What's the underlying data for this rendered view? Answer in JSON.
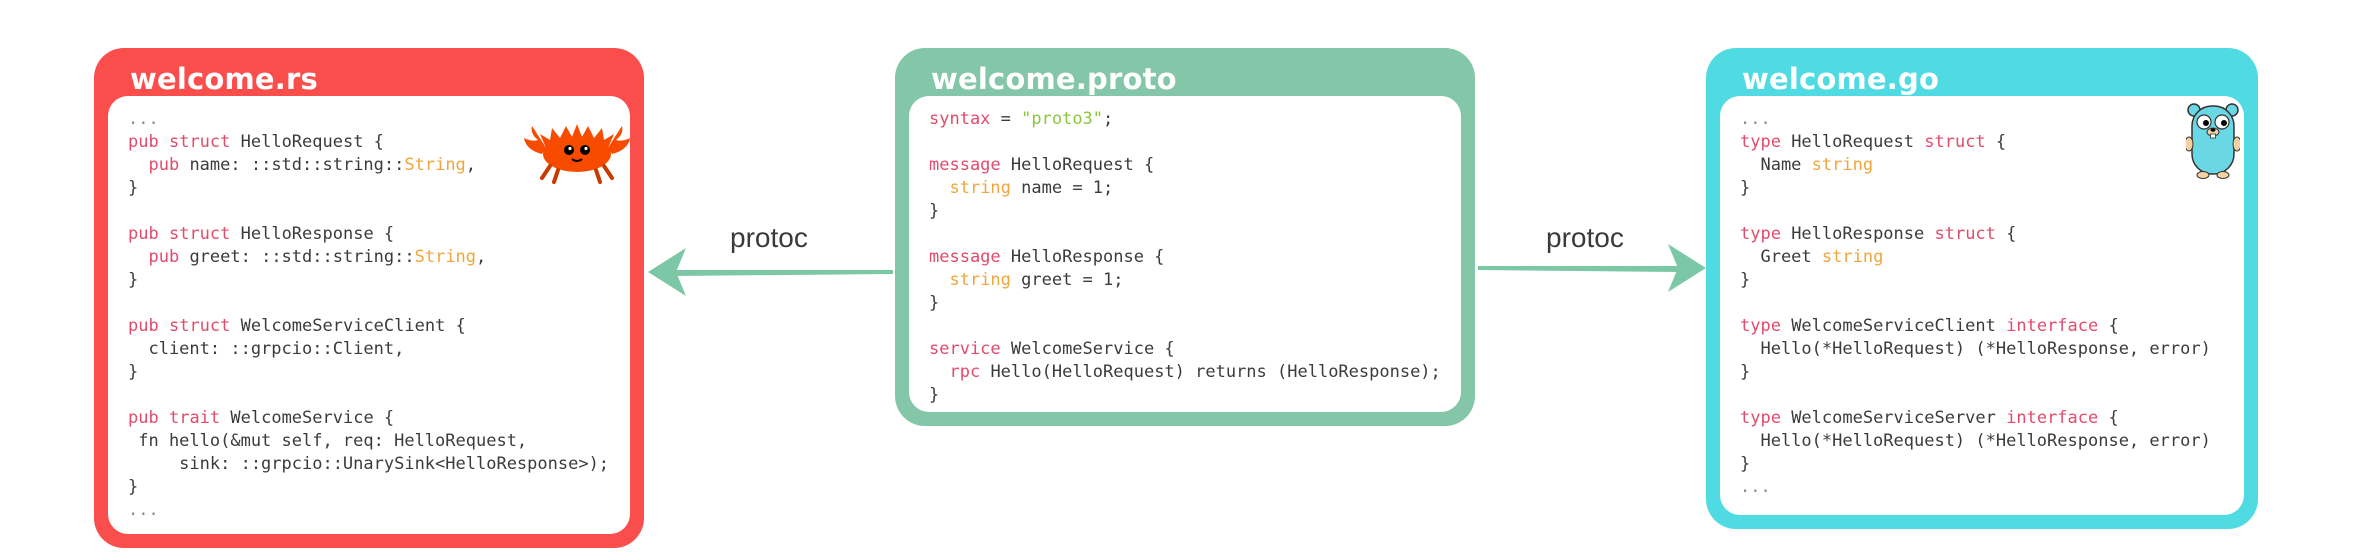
{
  "cards": {
    "rust": {
      "title": "welcome.rs",
      "lines": [
        [
          {
            "t": "...",
            "c": "dim"
          }
        ],
        [
          {
            "t": "pub",
            "c": "kw"
          },
          {
            "t": " "
          },
          {
            "t": "struct",
            "c": "kw"
          },
          {
            "t": " HelloRequest {"
          }
        ],
        [
          {
            "t": "  "
          },
          {
            "t": "pub",
            "c": "kw"
          },
          {
            "t": " name: ::std::string::"
          },
          {
            "t": "String",
            "c": "ty"
          },
          {
            "t": ","
          }
        ],
        [
          {
            "t": "}"
          }
        ],
        [
          {
            "t": ""
          }
        ],
        [
          {
            "t": "pub",
            "c": "kw"
          },
          {
            "t": " "
          },
          {
            "t": "struct",
            "c": "kw"
          },
          {
            "t": " HelloResponse {"
          }
        ],
        [
          {
            "t": "  "
          },
          {
            "t": "pub",
            "c": "kw"
          },
          {
            "t": " greet: ::std::string::"
          },
          {
            "t": "String",
            "c": "ty"
          },
          {
            "t": ","
          }
        ],
        [
          {
            "t": "}"
          }
        ],
        [
          {
            "t": ""
          }
        ],
        [
          {
            "t": "pub",
            "c": "kw"
          },
          {
            "t": " "
          },
          {
            "t": "struct",
            "c": "kw"
          },
          {
            "t": " WelcomeServiceClient {"
          }
        ],
        [
          {
            "t": "  client: ::grpcio::Client,"
          }
        ],
        [
          {
            "t": "}"
          }
        ],
        [
          {
            "t": ""
          }
        ],
        [
          {
            "t": "pub",
            "c": "kw"
          },
          {
            "t": " "
          },
          {
            "t": "trait",
            "c": "kw"
          },
          {
            "t": " WelcomeService {"
          }
        ],
        [
          {
            "t": " fn hello(&mut self, req: HelloRequest,"
          }
        ],
        [
          {
            "t": "     sink: ::grpcio::UnarySink<HelloResponse>);"
          }
        ],
        [
          {
            "t": "}"
          }
        ],
        [
          {
            "t": "...",
            "c": "dim"
          }
        ]
      ]
    },
    "proto": {
      "title": "welcome.proto",
      "lines": [
        [
          {
            "t": "syntax",
            "c": "kw"
          },
          {
            "t": " = "
          },
          {
            "t": "\"proto3\"",
            "c": "st"
          },
          {
            "t": ";"
          }
        ],
        [
          {
            "t": ""
          }
        ],
        [
          {
            "t": "message",
            "c": "kw"
          },
          {
            "t": " HelloRequest {"
          }
        ],
        [
          {
            "t": "  "
          },
          {
            "t": "string",
            "c": "ty"
          },
          {
            "t": " name = 1;"
          }
        ],
        [
          {
            "t": "}"
          }
        ],
        [
          {
            "t": ""
          }
        ],
        [
          {
            "t": "message",
            "c": "kw"
          },
          {
            "t": " HelloResponse {"
          }
        ],
        [
          {
            "t": "  "
          },
          {
            "t": "string",
            "c": "ty"
          },
          {
            "t": " greet = 1;"
          }
        ],
        [
          {
            "t": "}"
          }
        ],
        [
          {
            "t": ""
          }
        ],
        [
          {
            "t": "service",
            "c": "kw"
          },
          {
            "t": " WelcomeService {"
          }
        ],
        [
          {
            "t": "  "
          },
          {
            "t": "rpc",
            "c": "kw"
          },
          {
            "t": " Hello(HelloRequest) returns (HelloResponse);"
          }
        ],
        [
          {
            "t": "}"
          }
        ]
      ]
    },
    "go": {
      "title": "welcome.go",
      "lines": [
        [
          {
            "t": "...",
            "c": "dim"
          }
        ],
        [
          {
            "t": "type",
            "c": "kw"
          },
          {
            "t": " HelloRequest "
          },
          {
            "t": "struct",
            "c": "kw"
          },
          {
            "t": " {"
          }
        ],
        [
          {
            "t": "  Name "
          },
          {
            "t": "string",
            "c": "ty"
          }
        ],
        [
          {
            "t": "}"
          }
        ],
        [
          {
            "t": ""
          }
        ],
        [
          {
            "t": "type",
            "c": "kw"
          },
          {
            "t": " HelloResponse "
          },
          {
            "t": "struct",
            "c": "kw"
          },
          {
            "t": " {"
          }
        ],
        [
          {
            "t": "  Greet "
          },
          {
            "t": "string",
            "c": "ty"
          }
        ],
        [
          {
            "t": "}"
          }
        ],
        [
          {
            "t": ""
          }
        ],
        [
          {
            "t": "type",
            "c": "kw"
          },
          {
            "t": " WelcomeServiceClient "
          },
          {
            "t": "interface",
            "c": "kw"
          },
          {
            "t": " {"
          }
        ],
        [
          {
            "t": "  Hello(*HelloRequest) (*HelloResponse, error)"
          }
        ],
        [
          {
            "t": "}"
          }
        ],
        [
          {
            "t": ""
          }
        ],
        [
          {
            "t": "type",
            "c": "kw"
          },
          {
            "t": " WelcomeServiceServer "
          },
          {
            "t": "interface",
            "c": "kw"
          },
          {
            "t": " {"
          }
        ],
        [
          {
            "t": "  Hello(*HelloRequest) (*HelloResponse, error)"
          }
        ],
        [
          {
            "t": "}"
          }
        ],
        [
          {
            "t": "...",
            "c": "dim"
          }
        ]
      ]
    }
  },
  "arrows": {
    "left_label": "protoc",
    "right_label": "protoc",
    "color": "#7cc7a5"
  },
  "colors": {
    "rust": "#fa4e4d",
    "proto": "#83c6a8",
    "go": "#50dbe3",
    "keyword": "#e24b6d",
    "type": "#f0a63a",
    "string": "#8cc63f"
  },
  "icons": {
    "rust_mascot": "ferris-crab-icon",
    "go_mascot": "gopher-icon"
  }
}
